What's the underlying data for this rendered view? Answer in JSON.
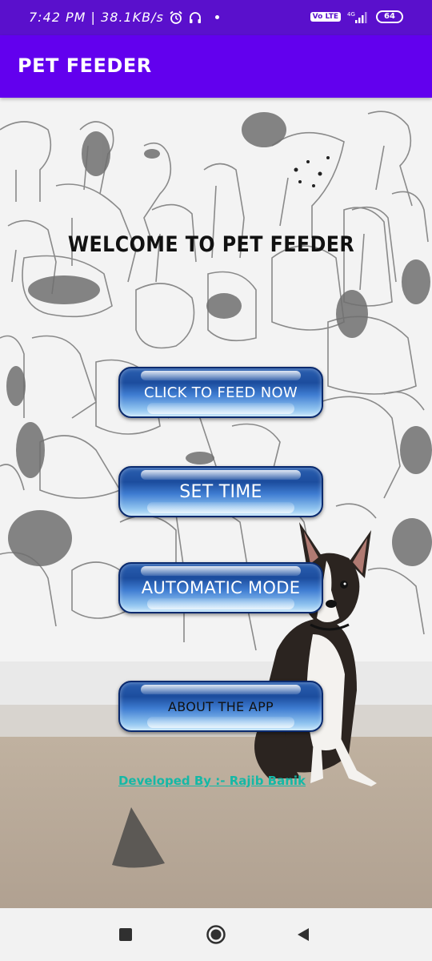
{
  "status_bar": {
    "time_and_speed": "7:42 PM | 38.1KB/s",
    "network_badge": "Vo LTE",
    "signal": "4G",
    "battery": "64"
  },
  "app_bar": {
    "title": "PET FEEDER"
  },
  "main": {
    "welcome": "WELCOME TO PET FEEDER",
    "buttons": {
      "feed_now": "CLICK TO FEED NOW",
      "set_time": "SET TIME",
      "automatic_mode": "AUTOMATIC MODE",
      "about": "ABOUT THE APP"
    },
    "developer_credit": "Developed By :- Rajib Banik"
  },
  "colors": {
    "status_bar": "#5a10cc",
    "app_bar": "#6200ee",
    "button_dark": "#1c4d9e",
    "button_light": "#c6e6fb",
    "credit": "#15b8a6"
  },
  "icons": {
    "status": [
      "alarm-icon",
      "headphones-icon",
      "signal-icon",
      "battery-icon"
    ],
    "nav": [
      "recents-icon",
      "home-icon",
      "back-icon"
    ]
  }
}
